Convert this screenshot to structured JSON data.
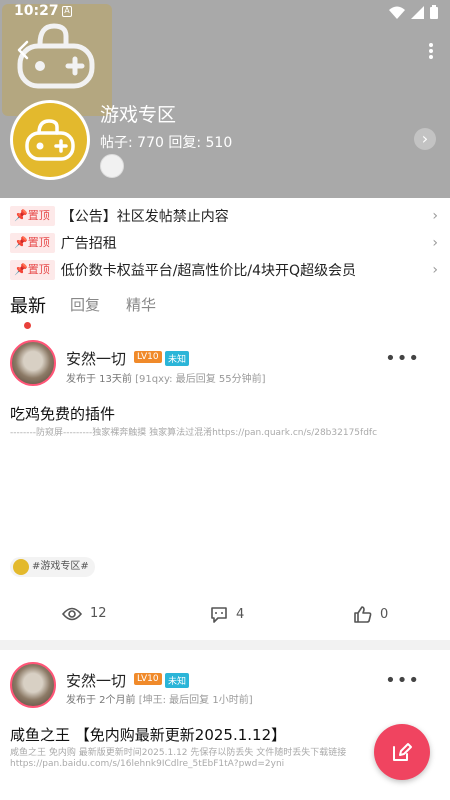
{
  "status_bar": {
    "time": "10:27",
    "sim_label": "A"
  },
  "zone": {
    "title": "游戏专区",
    "stats": "帖子: 770 回复: 510",
    "arrow": "›"
  },
  "pinned": [
    {
      "badge": "置顶",
      "text": "【公告】社区发帖禁止内容"
    },
    {
      "badge": "置顶",
      "text": "广告招租"
    },
    {
      "badge": "置顶",
      "text": "低价数卡权益平台/超高性价比/4块开Q超级会员"
    }
  ],
  "tabs": [
    {
      "label": "最新"
    },
    {
      "label": "回复"
    },
    {
      "label": "精华"
    }
  ],
  "posts": [
    {
      "username": "安然一切",
      "level": "LV10",
      "gender": "未知",
      "posted": "发布于 13天前",
      "last_reply": "[91qxy: 最后回复 55分钟前]",
      "title": "吃鸡免费的插件",
      "body": "--------防窥屏---------独家裸奔触摸 独家算法过混淆https://pan.quark.cn/s/28b32175fdfc",
      "tag": "#游戏专区#",
      "views": "12",
      "comments": "4",
      "likes": "0"
    },
    {
      "username": "安然一切",
      "level": "LV10",
      "gender": "未知",
      "posted": "发布于 2个月前",
      "last_reply": "[坤王: 最后回复 1小时前]",
      "title": "咸鱼之王 【免内购最新更新2025.1.12】",
      "body": "咸鱼之王 免内购 最新版更新时间2025.1.12 先保存以防丢失 文件随时丢失下载链接",
      "body2": "https://pan.baidu.com/s/16lehnk9ICdlre_5tEbF1tA?pwd=2yni"
    }
  ],
  "colors": {
    "accent": "#f04460",
    "pin_red": "#e74c4c",
    "zone_yellow": "#e3b92d",
    "level_orange": "#f08a2a",
    "gender_blue": "#2bb5d8"
  }
}
